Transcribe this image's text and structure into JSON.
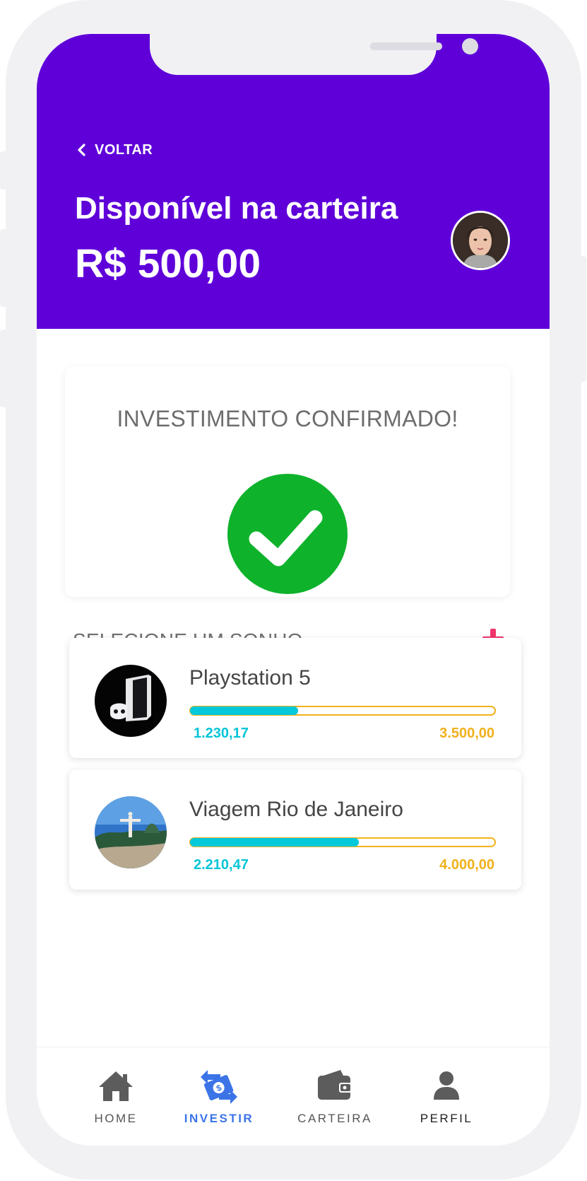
{
  "header": {
    "back_label": "VOLTAR",
    "title": "Disponível na carteira",
    "balance": "R$ 500,00"
  },
  "confirmation": {
    "message": "INVESTIMENTO CONFIRMADO!",
    "icon": "check-circle-icon",
    "color": "#0eb22b"
  },
  "dreams_section": {
    "title": "SELECIONE UM SONHO",
    "add_icon": "plus-icon",
    "add_color": "#f0356b"
  },
  "dreams": [
    {
      "name": "Playstation 5",
      "current": "1.230,17",
      "goal": "3.500,00",
      "progress": 0.35
    },
    {
      "name": "Viagem Rio de Janeiro",
      "current": "2.210,47",
      "goal": "4.000,00",
      "progress": 0.55
    }
  ],
  "nav": {
    "items": [
      {
        "label": "HOME",
        "icon": "home-icon",
        "active": false
      },
      {
        "label": "INVESTIR",
        "icon": "money-transfer-icon",
        "active": true
      },
      {
        "label": "CARTEIRA",
        "icon": "wallet-icon",
        "active": false
      },
      {
        "label": "PERFIL",
        "icon": "user-icon",
        "active": false
      }
    ]
  },
  "colors": {
    "header_bg": "#5f00d9",
    "progress_fill": "#04c9db",
    "progress_border": "#f2b21c",
    "nav_active": "#3c74e8"
  }
}
